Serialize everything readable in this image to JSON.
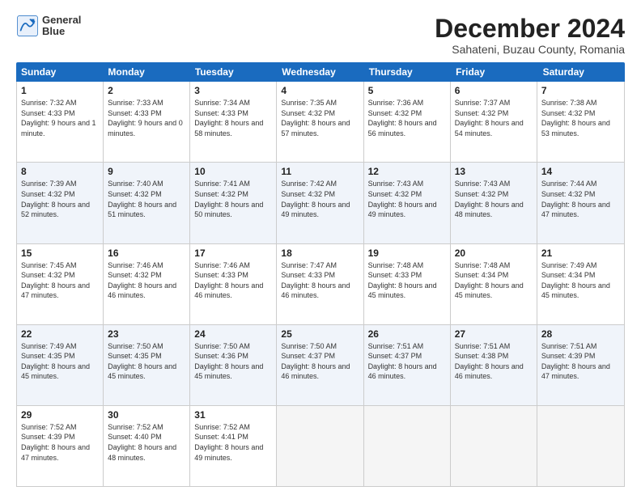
{
  "header": {
    "logo_line1": "General",
    "logo_line2": "Blue",
    "title": "December 2024",
    "subtitle": "Sahateni, Buzau County, Romania"
  },
  "days": [
    "Sunday",
    "Monday",
    "Tuesday",
    "Wednesday",
    "Thursday",
    "Friday",
    "Saturday"
  ],
  "weeks": [
    [
      {
        "day": "1",
        "sunrise": "7:32 AM",
        "sunset": "4:33 PM",
        "daylight": "9 hours and 1 minute."
      },
      {
        "day": "2",
        "sunrise": "7:33 AM",
        "sunset": "4:33 PM",
        "daylight": "9 hours and 0 minutes."
      },
      {
        "day": "3",
        "sunrise": "7:34 AM",
        "sunset": "4:33 PM",
        "daylight": "8 hours and 58 minutes."
      },
      {
        "day": "4",
        "sunrise": "7:35 AM",
        "sunset": "4:32 PM",
        "daylight": "8 hours and 57 minutes."
      },
      {
        "day": "5",
        "sunrise": "7:36 AM",
        "sunset": "4:32 PM",
        "daylight": "8 hours and 56 minutes."
      },
      {
        "day": "6",
        "sunrise": "7:37 AM",
        "sunset": "4:32 PM",
        "daylight": "8 hours and 54 minutes."
      },
      {
        "day": "7",
        "sunrise": "7:38 AM",
        "sunset": "4:32 PM",
        "daylight": "8 hours and 53 minutes."
      }
    ],
    [
      {
        "day": "8",
        "sunrise": "7:39 AM",
        "sunset": "4:32 PM",
        "daylight": "8 hours and 52 minutes."
      },
      {
        "day": "9",
        "sunrise": "7:40 AM",
        "sunset": "4:32 PM",
        "daylight": "8 hours and 51 minutes."
      },
      {
        "day": "10",
        "sunrise": "7:41 AM",
        "sunset": "4:32 PM",
        "daylight": "8 hours and 50 minutes."
      },
      {
        "day": "11",
        "sunrise": "7:42 AM",
        "sunset": "4:32 PM",
        "daylight": "8 hours and 49 minutes."
      },
      {
        "day": "12",
        "sunrise": "7:43 AM",
        "sunset": "4:32 PM",
        "daylight": "8 hours and 49 minutes."
      },
      {
        "day": "13",
        "sunrise": "7:43 AM",
        "sunset": "4:32 PM",
        "daylight": "8 hours and 48 minutes."
      },
      {
        "day": "14",
        "sunrise": "7:44 AM",
        "sunset": "4:32 PM",
        "daylight": "8 hours and 47 minutes."
      }
    ],
    [
      {
        "day": "15",
        "sunrise": "7:45 AM",
        "sunset": "4:32 PM",
        "daylight": "8 hours and 47 minutes."
      },
      {
        "day": "16",
        "sunrise": "7:46 AM",
        "sunset": "4:32 PM",
        "daylight": "8 hours and 46 minutes."
      },
      {
        "day": "17",
        "sunrise": "7:46 AM",
        "sunset": "4:33 PM",
        "daylight": "8 hours and 46 minutes."
      },
      {
        "day": "18",
        "sunrise": "7:47 AM",
        "sunset": "4:33 PM",
        "daylight": "8 hours and 46 minutes."
      },
      {
        "day": "19",
        "sunrise": "7:48 AM",
        "sunset": "4:33 PM",
        "daylight": "8 hours and 45 minutes."
      },
      {
        "day": "20",
        "sunrise": "7:48 AM",
        "sunset": "4:34 PM",
        "daylight": "8 hours and 45 minutes."
      },
      {
        "day": "21",
        "sunrise": "7:49 AM",
        "sunset": "4:34 PM",
        "daylight": "8 hours and 45 minutes."
      }
    ],
    [
      {
        "day": "22",
        "sunrise": "7:49 AM",
        "sunset": "4:35 PM",
        "daylight": "8 hours and 45 minutes."
      },
      {
        "day": "23",
        "sunrise": "7:50 AM",
        "sunset": "4:35 PM",
        "daylight": "8 hours and 45 minutes."
      },
      {
        "day": "24",
        "sunrise": "7:50 AM",
        "sunset": "4:36 PM",
        "daylight": "8 hours and 45 minutes."
      },
      {
        "day": "25",
        "sunrise": "7:50 AM",
        "sunset": "4:37 PM",
        "daylight": "8 hours and 46 minutes."
      },
      {
        "day": "26",
        "sunrise": "7:51 AM",
        "sunset": "4:37 PM",
        "daylight": "8 hours and 46 minutes."
      },
      {
        "day": "27",
        "sunrise": "7:51 AM",
        "sunset": "4:38 PM",
        "daylight": "8 hours and 46 minutes."
      },
      {
        "day": "28",
        "sunrise": "7:51 AM",
        "sunset": "4:39 PM",
        "daylight": "8 hours and 47 minutes."
      }
    ],
    [
      {
        "day": "29",
        "sunrise": "7:52 AM",
        "sunset": "4:39 PM",
        "daylight": "8 hours and 47 minutes."
      },
      {
        "day": "30",
        "sunrise": "7:52 AM",
        "sunset": "4:40 PM",
        "daylight": "8 hours and 48 minutes."
      },
      {
        "day": "31",
        "sunrise": "7:52 AM",
        "sunset": "4:41 PM",
        "daylight": "8 hours and 49 minutes."
      },
      null,
      null,
      null,
      null
    ]
  ],
  "colors": {
    "header_bg": "#1a6bbf",
    "alt_row_bg": "#f0f4fa",
    "empty_bg": "#f5f5f5"
  }
}
